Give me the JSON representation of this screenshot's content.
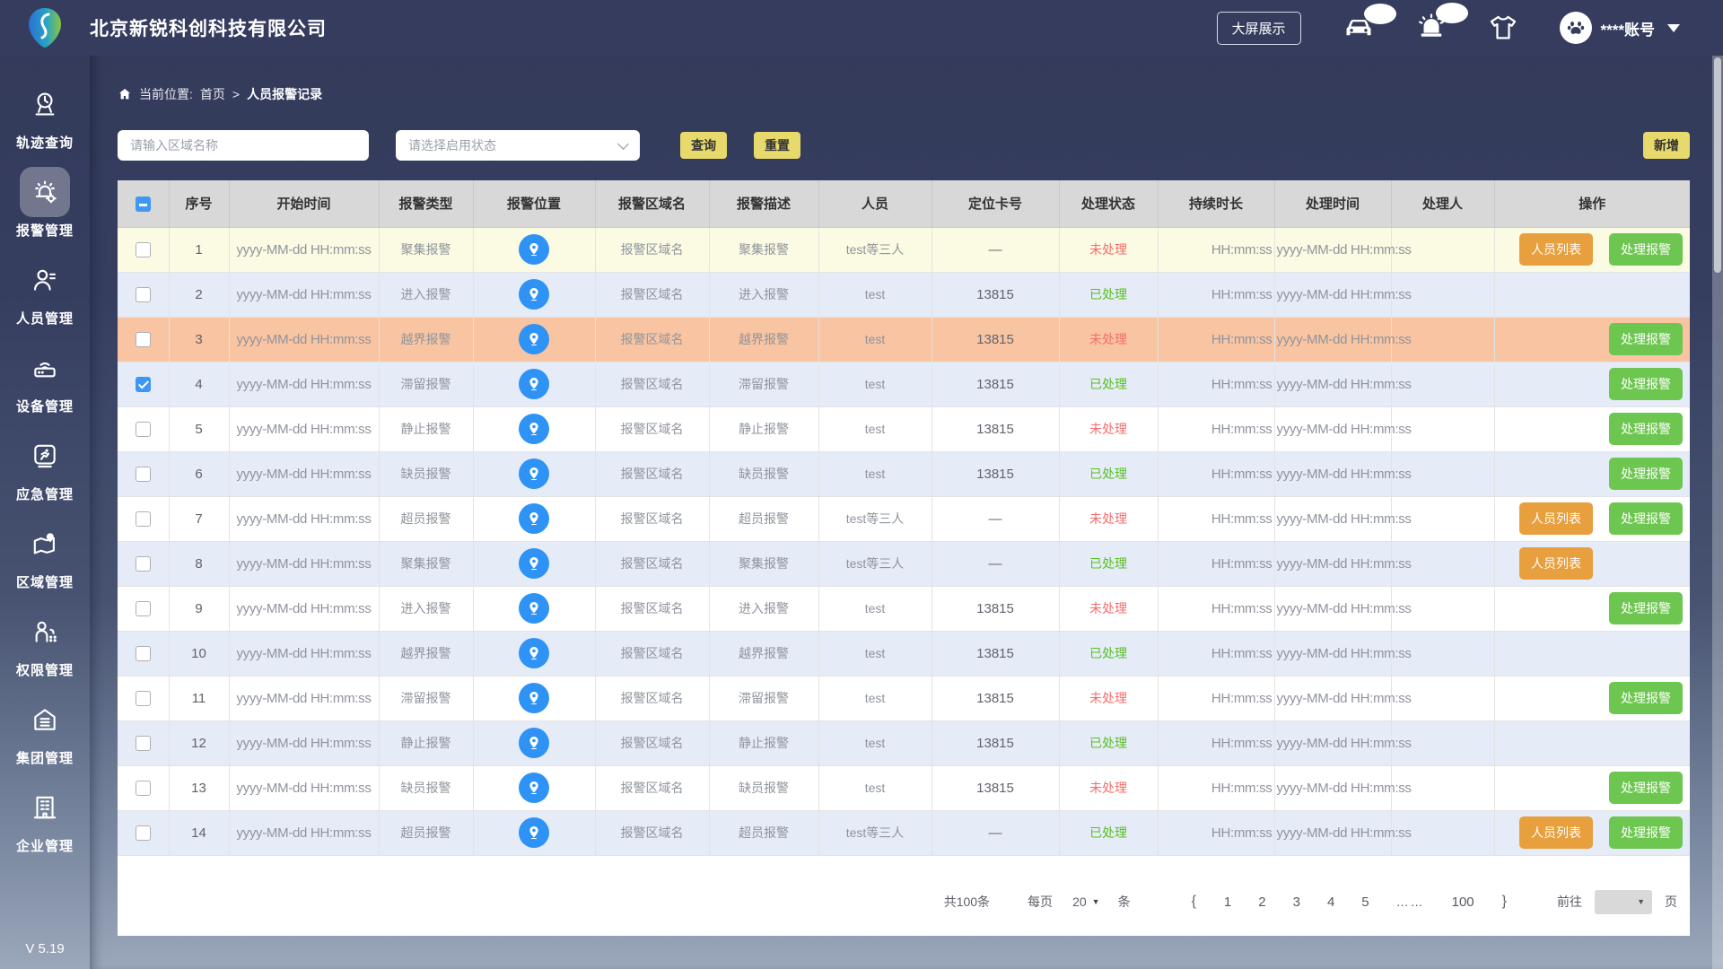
{
  "header": {
    "company_name": "北京新锐科创科技有限公司",
    "big_screen_label": "大屏展示",
    "account_label": "****账号"
  },
  "sidebar": {
    "items": [
      {
        "label": "轨迹查询",
        "icon": "track-query-icon",
        "active": false
      },
      {
        "label": "报警管理",
        "icon": "alarm-manage-icon",
        "active": true
      },
      {
        "label": "人员管理",
        "icon": "personnel-manage-icon",
        "active": false
      },
      {
        "label": "设备管理",
        "icon": "device-manage-icon",
        "active": false
      },
      {
        "label": "应急管理",
        "icon": "emergency-manage-icon",
        "active": false
      },
      {
        "label": "区域管理",
        "icon": "region-manage-icon",
        "active": false
      },
      {
        "label": "权限管理",
        "icon": "permission-manage-icon",
        "active": false
      },
      {
        "label": "集团管理",
        "icon": "group-manage-icon",
        "active": false
      },
      {
        "label": "企业管理",
        "icon": "enterprise-manage-icon",
        "active": false
      }
    ],
    "version": "V 5.19"
  },
  "breadcrumb": {
    "label": "当前位置: ",
    "root": "首页",
    "separator": ">",
    "current": "人员报警记录"
  },
  "filters": {
    "area_input_placeholder": "请输入区域名称",
    "status_select_placeholder": "请选择启用状态",
    "query_label": "查询",
    "reset_label": "重置",
    "add_label": "新增"
  },
  "table": {
    "columns": [
      "序号",
      "开始时间",
      "报警类型",
      "报警位置",
      "报警区域名",
      "报警描述",
      "人员",
      "定位卡号",
      "处理状态",
      "持续时长",
      "处理时间",
      "处理人",
      "操作"
    ],
    "action_labels": {
      "person_list": "人员列表",
      "handle": "处理报警"
    },
    "rows": [
      {
        "no": "1",
        "start_time": "yyyy-MM-dd HH:mm:ss",
        "alarm_type": "聚集报警",
        "area_name": "报警区域名",
        "description": "聚集报警",
        "person": "test等三人",
        "card_no": "—",
        "status": "未处理",
        "status_state": "pending",
        "duration": "HH:mm:ss",
        "handle_time": "yyyy-MM-dd HH:mm:ss",
        "handler": "",
        "row_color": "yellow",
        "checked": false,
        "has_person_list": true,
        "has_handle": true
      },
      {
        "no": "2",
        "start_time": "yyyy-MM-dd HH:mm:ss",
        "alarm_type": "进入报警",
        "area_name": "报警区域名",
        "description": "进入报警",
        "person": "test",
        "card_no": "13815",
        "status": "已处理",
        "status_state": "done",
        "duration": "HH:mm:ss",
        "handle_time": "yyyy-MM-dd HH:mm:ss",
        "handler": "",
        "row_color": "blue",
        "checked": false,
        "has_person_list": false,
        "has_handle": false
      },
      {
        "no": "3",
        "start_time": "yyyy-MM-dd HH:mm:ss",
        "alarm_type": "越界报警",
        "area_name": "报警区域名",
        "description": "越界报警",
        "person": "test",
        "card_no": "13815",
        "status": "未处理",
        "status_state": "pending",
        "duration": "HH:mm:ss",
        "handle_time": "yyyy-MM-dd HH:mm:ss",
        "handler": "",
        "row_color": "salmon",
        "checked": false,
        "has_person_list": false,
        "has_handle": true
      },
      {
        "no": "4",
        "start_time": "yyyy-MM-dd HH:mm:ss",
        "alarm_type": "滞留报警",
        "area_name": "报警区域名",
        "description": "滞留报警",
        "person": "test",
        "card_no": "13815",
        "status": "已处理",
        "status_state": "done",
        "duration": "HH:mm:ss",
        "handle_time": "yyyy-MM-dd HH:mm:ss",
        "handler": "",
        "row_color": "blue",
        "checked": true,
        "has_person_list": false,
        "has_handle": true
      },
      {
        "no": "5",
        "start_time": "yyyy-MM-dd HH:mm:ss",
        "alarm_type": "静止报警",
        "area_name": "报警区域名",
        "description": "静止报警",
        "person": "test",
        "card_no": "13815",
        "status": "未处理",
        "status_state": "pending",
        "duration": "HH:mm:ss",
        "handle_time": "yyyy-MM-dd HH:mm:ss",
        "handler": "",
        "row_color": "white",
        "checked": false,
        "has_person_list": false,
        "has_handle": true
      },
      {
        "no": "6",
        "start_time": "yyyy-MM-dd HH:mm:ss",
        "alarm_type": "缺员报警",
        "area_name": "报警区域名",
        "description": "缺员报警",
        "person": "test",
        "card_no": "13815",
        "status": "已处理",
        "status_state": "done",
        "duration": "HH:mm:ss",
        "handle_time": "yyyy-MM-dd HH:mm:ss",
        "handler": "",
        "row_color": "blue",
        "checked": false,
        "has_person_list": false,
        "has_handle": true
      },
      {
        "no": "7",
        "start_time": "yyyy-MM-dd HH:mm:ss",
        "alarm_type": "超员报警",
        "area_name": "报警区域名",
        "description": "超员报警",
        "person": "test等三人",
        "card_no": "—",
        "status": "未处理",
        "status_state": "pending",
        "duration": "HH:mm:ss",
        "handle_time": "yyyy-MM-dd HH:mm:ss",
        "handler": "",
        "row_color": "white",
        "checked": false,
        "has_person_list": true,
        "has_handle": true
      },
      {
        "no": "8",
        "start_time": "yyyy-MM-dd HH:mm:ss",
        "alarm_type": "聚集报警",
        "area_name": "报警区域名",
        "description": "聚集报警",
        "person": "test等三人",
        "card_no": "—",
        "status": "已处理",
        "status_state": "done",
        "duration": "HH:mm:ss",
        "handle_time": "yyyy-MM-dd HH:mm:ss",
        "handler": "",
        "row_color": "blue",
        "checked": false,
        "has_person_list": true,
        "has_handle": false
      },
      {
        "no": "9",
        "start_time": "yyyy-MM-dd HH:mm:ss",
        "alarm_type": "进入报警",
        "area_name": "报警区域名",
        "description": "进入报警",
        "person": "test",
        "card_no": "13815",
        "status": "未处理",
        "status_state": "pending",
        "duration": "HH:mm:ss",
        "handle_time": "yyyy-MM-dd HH:mm:ss",
        "handler": "",
        "row_color": "white",
        "checked": false,
        "has_person_list": false,
        "has_handle": true
      },
      {
        "no": "10",
        "start_time": "yyyy-MM-dd HH:mm:ss",
        "alarm_type": "越界报警",
        "area_name": "报警区域名",
        "description": "越界报警",
        "person": "test",
        "card_no": "13815",
        "status": "已处理",
        "status_state": "done",
        "duration": "HH:mm:ss",
        "handle_time": "yyyy-MM-dd HH:mm:ss",
        "handler": "",
        "row_color": "blue",
        "checked": false,
        "has_person_list": false,
        "has_handle": false
      },
      {
        "no": "11",
        "start_time": "yyyy-MM-dd HH:mm:ss",
        "alarm_type": "滞留报警",
        "area_name": "报警区域名",
        "description": "滞留报警",
        "person": "test",
        "card_no": "13815",
        "status": "未处理",
        "status_state": "pending",
        "duration": "HH:mm:ss",
        "handle_time": "yyyy-MM-dd HH:mm:ss",
        "handler": "",
        "row_color": "white",
        "checked": false,
        "has_person_list": false,
        "has_handle": true
      },
      {
        "no": "12",
        "start_time": "yyyy-MM-dd HH:mm:ss",
        "alarm_type": "静止报警",
        "area_name": "报警区域名",
        "description": "静止报警",
        "person": "test",
        "card_no": "13815",
        "status": "已处理",
        "status_state": "done",
        "duration": "HH:mm:ss",
        "handle_time": "yyyy-MM-dd HH:mm:ss",
        "handler": "",
        "row_color": "blue",
        "checked": false,
        "has_person_list": false,
        "has_handle": false
      },
      {
        "no": "13",
        "start_time": "yyyy-MM-dd HH:mm:ss",
        "alarm_type": "缺员报警",
        "area_name": "报警区域名",
        "description": "缺员报警",
        "person": "test",
        "card_no": "13815",
        "status": "未处理",
        "status_state": "pending",
        "duration": "HH:mm:ss",
        "handle_time": "yyyy-MM-dd HH:mm:ss",
        "handler": "",
        "row_color": "white",
        "checked": false,
        "has_person_list": false,
        "has_handle": true
      },
      {
        "no": "14",
        "start_time": "yyyy-MM-dd HH:mm:ss",
        "alarm_type": "超员报警",
        "area_name": "报警区域名",
        "description": "超员报警",
        "person": "test等三人",
        "card_no": "—",
        "status": "已处理",
        "status_state": "done",
        "duration": "HH:mm:ss",
        "handle_time": "yyyy-MM-dd HH:mm:ss",
        "handler": "",
        "row_color": "blue",
        "checked": false,
        "has_person_list": true,
        "has_handle": true
      }
    ]
  },
  "pagination": {
    "total_label": "共100条",
    "per_page_prefix": "每页",
    "per_page_value": "20",
    "per_page_suffix": "条",
    "prev_label": "{",
    "pages": [
      "1",
      "2",
      "3",
      "4",
      "5",
      "……",
      "100"
    ],
    "next_label": "}",
    "goto_label": "前往",
    "page_suffix": "页"
  },
  "colors": {
    "header_navy": "#353c5e",
    "accent_yellow": "#e7d96b",
    "status_pending_red": "#f56c6c",
    "status_done_green": "#58c020",
    "button_orange": "#e89f3e",
    "button_green": "#6dc650",
    "row_yellow": "#fbfbe3",
    "row_blue": "#e6ebf8",
    "row_salmon": "#f9c4a2",
    "location_icon_blue": "#2e93f5",
    "checkbox_blue": "#3e97f2"
  }
}
